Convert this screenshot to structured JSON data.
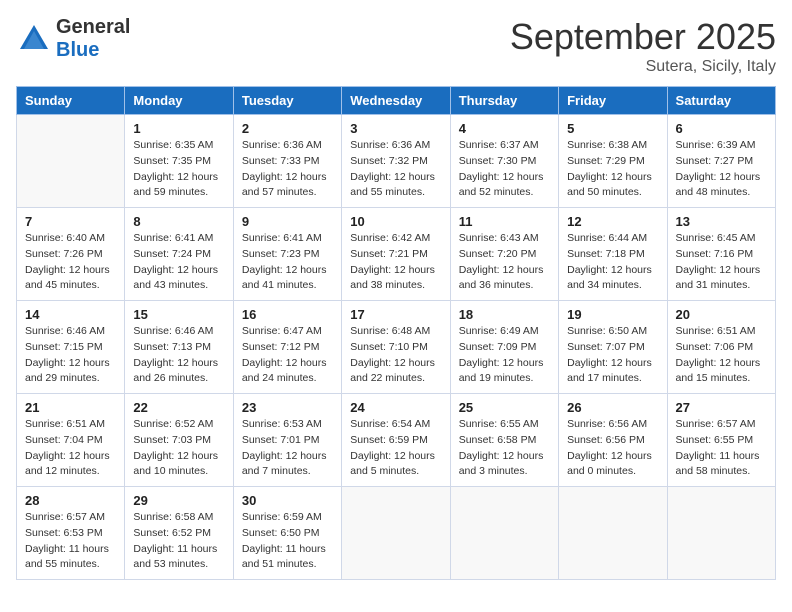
{
  "logo": {
    "general": "General",
    "blue": "Blue"
  },
  "title": "September 2025",
  "subtitle": "Sutera, Sicily, Italy",
  "days_header": [
    "Sunday",
    "Monday",
    "Tuesday",
    "Wednesday",
    "Thursday",
    "Friday",
    "Saturday"
  ],
  "weeks": [
    [
      {
        "day": "",
        "info": ""
      },
      {
        "day": "1",
        "info": "Sunrise: 6:35 AM\nSunset: 7:35 PM\nDaylight: 12 hours\nand 59 minutes."
      },
      {
        "day": "2",
        "info": "Sunrise: 6:36 AM\nSunset: 7:33 PM\nDaylight: 12 hours\nand 57 minutes."
      },
      {
        "day": "3",
        "info": "Sunrise: 6:36 AM\nSunset: 7:32 PM\nDaylight: 12 hours\nand 55 minutes."
      },
      {
        "day": "4",
        "info": "Sunrise: 6:37 AM\nSunset: 7:30 PM\nDaylight: 12 hours\nand 52 minutes."
      },
      {
        "day": "5",
        "info": "Sunrise: 6:38 AM\nSunset: 7:29 PM\nDaylight: 12 hours\nand 50 minutes."
      },
      {
        "day": "6",
        "info": "Sunrise: 6:39 AM\nSunset: 7:27 PM\nDaylight: 12 hours\nand 48 minutes."
      }
    ],
    [
      {
        "day": "7",
        "info": "Sunrise: 6:40 AM\nSunset: 7:26 PM\nDaylight: 12 hours\nand 45 minutes."
      },
      {
        "day": "8",
        "info": "Sunrise: 6:41 AM\nSunset: 7:24 PM\nDaylight: 12 hours\nand 43 minutes."
      },
      {
        "day": "9",
        "info": "Sunrise: 6:41 AM\nSunset: 7:23 PM\nDaylight: 12 hours\nand 41 minutes."
      },
      {
        "day": "10",
        "info": "Sunrise: 6:42 AM\nSunset: 7:21 PM\nDaylight: 12 hours\nand 38 minutes."
      },
      {
        "day": "11",
        "info": "Sunrise: 6:43 AM\nSunset: 7:20 PM\nDaylight: 12 hours\nand 36 minutes."
      },
      {
        "day": "12",
        "info": "Sunrise: 6:44 AM\nSunset: 7:18 PM\nDaylight: 12 hours\nand 34 minutes."
      },
      {
        "day": "13",
        "info": "Sunrise: 6:45 AM\nSunset: 7:16 PM\nDaylight: 12 hours\nand 31 minutes."
      }
    ],
    [
      {
        "day": "14",
        "info": "Sunrise: 6:46 AM\nSunset: 7:15 PM\nDaylight: 12 hours\nand 29 minutes."
      },
      {
        "day": "15",
        "info": "Sunrise: 6:46 AM\nSunset: 7:13 PM\nDaylight: 12 hours\nand 26 minutes."
      },
      {
        "day": "16",
        "info": "Sunrise: 6:47 AM\nSunset: 7:12 PM\nDaylight: 12 hours\nand 24 minutes."
      },
      {
        "day": "17",
        "info": "Sunrise: 6:48 AM\nSunset: 7:10 PM\nDaylight: 12 hours\nand 22 minutes."
      },
      {
        "day": "18",
        "info": "Sunrise: 6:49 AM\nSunset: 7:09 PM\nDaylight: 12 hours\nand 19 minutes."
      },
      {
        "day": "19",
        "info": "Sunrise: 6:50 AM\nSunset: 7:07 PM\nDaylight: 12 hours\nand 17 minutes."
      },
      {
        "day": "20",
        "info": "Sunrise: 6:51 AM\nSunset: 7:06 PM\nDaylight: 12 hours\nand 15 minutes."
      }
    ],
    [
      {
        "day": "21",
        "info": "Sunrise: 6:51 AM\nSunset: 7:04 PM\nDaylight: 12 hours\nand 12 minutes."
      },
      {
        "day": "22",
        "info": "Sunrise: 6:52 AM\nSunset: 7:03 PM\nDaylight: 12 hours\nand 10 minutes."
      },
      {
        "day": "23",
        "info": "Sunrise: 6:53 AM\nSunset: 7:01 PM\nDaylight: 12 hours\nand 7 minutes."
      },
      {
        "day": "24",
        "info": "Sunrise: 6:54 AM\nSunset: 6:59 PM\nDaylight: 12 hours\nand 5 minutes."
      },
      {
        "day": "25",
        "info": "Sunrise: 6:55 AM\nSunset: 6:58 PM\nDaylight: 12 hours\nand 3 minutes."
      },
      {
        "day": "26",
        "info": "Sunrise: 6:56 AM\nSunset: 6:56 PM\nDaylight: 12 hours\nand 0 minutes."
      },
      {
        "day": "27",
        "info": "Sunrise: 6:57 AM\nSunset: 6:55 PM\nDaylight: 11 hours\nand 58 minutes."
      }
    ],
    [
      {
        "day": "28",
        "info": "Sunrise: 6:57 AM\nSunset: 6:53 PM\nDaylight: 11 hours\nand 55 minutes."
      },
      {
        "day": "29",
        "info": "Sunrise: 6:58 AM\nSunset: 6:52 PM\nDaylight: 11 hours\nand 53 minutes."
      },
      {
        "day": "30",
        "info": "Sunrise: 6:59 AM\nSunset: 6:50 PM\nDaylight: 11 hours\nand 51 minutes."
      },
      {
        "day": "",
        "info": ""
      },
      {
        "day": "",
        "info": ""
      },
      {
        "day": "",
        "info": ""
      },
      {
        "day": "",
        "info": ""
      }
    ]
  ]
}
